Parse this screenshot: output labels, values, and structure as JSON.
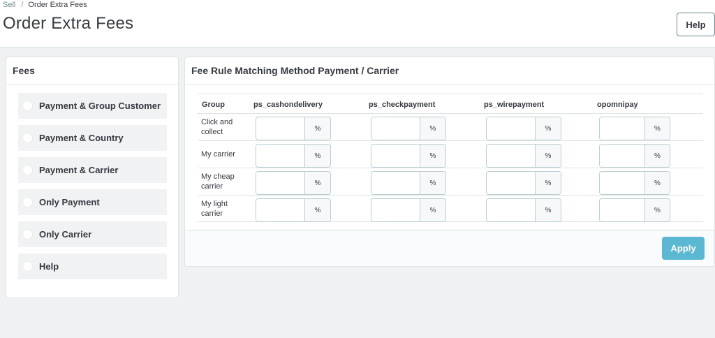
{
  "breadcrumb": {
    "parent": "Sell",
    "separator": "/",
    "current": "Order Extra Fees"
  },
  "page_title": "Order Extra Fees",
  "help_button": "Help",
  "fees_panel": {
    "title": "Fees",
    "options": [
      {
        "label": "Payment & Group Customer"
      },
      {
        "label": "Payment & Country"
      },
      {
        "label": "Payment & Carrier"
      },
      {
        "label": "Only Payment"
      },
      {
        "label": "Only Carrier"
      },
      {
        "label": "Help"
      }
    ]
  },
  "rule_panel": {
    "title": "Fee Rule Matching Method Payment / Carrier",
    "columns": [
      "Group",
      "ps_cashondelivery",
      "ps_checkpayment",
      "ps_wirepayment",
      "opomnipay"
    ],
    "rows": [
      {
        "group": "Click and collect"
      },
      {
        "group": "My carrier"
      },
      {
        "group": "My cheap carrier"
      },
      {
        "group": "My light carrier"
      }
    ],
    "unit": "%",
    "input_value": "",
    "apply_button": "Apply"
  },
  "colors": {
    "primary": "#5bb8d3",
    "page_bg": "#eff1f2",
    "text": "#363a41"
  }
}
